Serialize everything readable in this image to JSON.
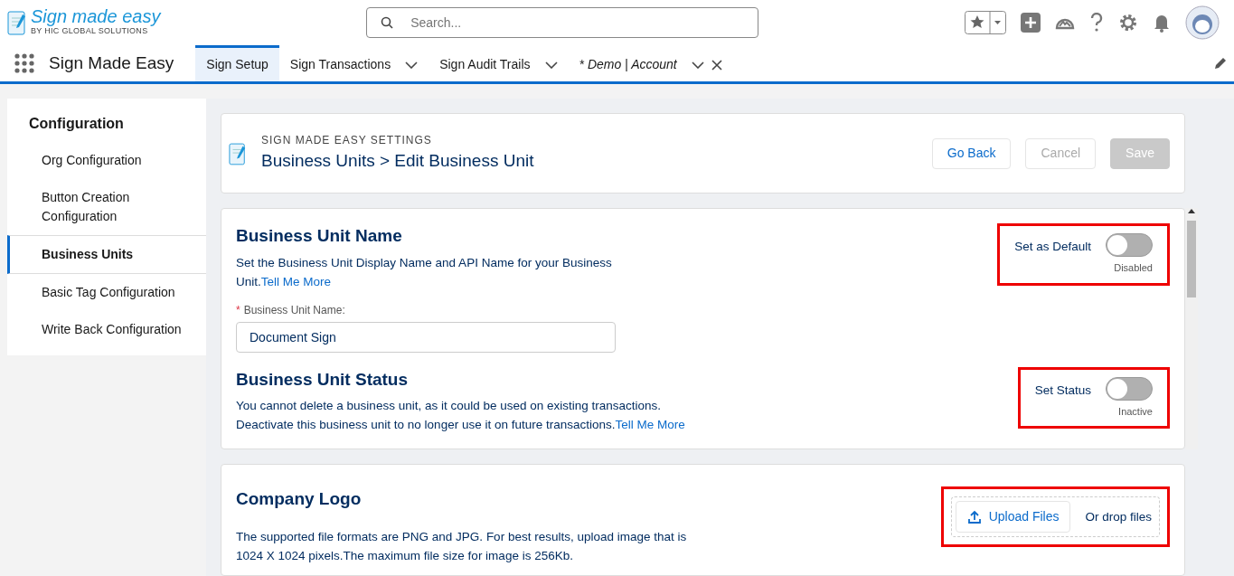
{
  "header": {
    "logo_title": "Sign made easy",
    "logo_subtitle": "BY HIC GLOBAL SOLUTIONS",
    "search": {
      "placeholder": "Search..."
    }
  },
  "nav": {
    "app_name": "Sign Made Easy",
    "tabs": [
      {
        "label": "Sign Setup",
        "selected": true,
        "italic": false,
        "dropdown": false,
        "closable": false
      },
      {
        "label": "Sign Transactions",
        "selected": false,
        "italic": false,
        "dropdown": true,
        "closable": false
      },
      {
        "label": "Sign Audit Trails",
        "selected": false,
        "italic": false,
        "dropdown": true,
        "closable": false
      },
      {
        "label": "* Demo | Account",
        "selected": false,
        "italic": true,
        "dropdown": true,
        "closable": true
      }
    ]
  },
  "sidebar": {
    "title": "Configuration",
    "items": [
      {
        "label": "Org Configuration",
        "selected": false
      },
      {
        "label": "Button Creation Configuration",
        "selected": false
      },
      {
        "label": "Business Units",
        "selected": true
      },
      {
        "label": "Basic Tag Configuration",
        "selected": false
      },
      {
        "label": "Write Back Configuration",
        "selected": false
      }
    ]
  },
  "page_header": {
    "eyebrow": "SIGN MADE EASY SETTINGS",
    "title": "Business Units > Edit Business Unit",
    "buttons": [
      {
        "label": "Go Back",
        "kind": "link"
      },
      {
        "label": "Cancel",
        "kind": "muted"
      },
      {
        "label": "Save",
        "kind": "disabled"
      }
    ]
  },
  "sections": [
    {
      "title": "Business Unit Name",
      "text": "Set the Business Unit Display Name and API Name for your Business Unit.",
      "link": "Tell Me More",
      "field": {
        "label": "Business Unit Name:",
        "required_mark": "*",
        "value": "Document Sign"
      },
      "toggle": {
        "label": "Set as Default",
        "on": false,
        "state_text": "Disabled",
        "highlighted": true
      }
    },
    {
      "title": "Business Unit Status",
      "text": "You cannot delete a business unit, as it could be used on existing transactions. Deactivate this business unit to no longer use it on future transactions.",
      "link": "Tell Me More",
      "toggle": {
        "label": "Set Status",
        "on": false,
        "state_text": "Inactive",
        "highlighted": true
      }
    }
  ],
  "logo_card": {
    "title": "Company Logo",
    "text": "The supported file formats are PNG and JPG. For best results, upload image that is 1024 X 1024 pixels.The maximum file size for image is 256Kb.",
    "upload_button": "Upload Files",
    "drop_text": "Or drop files",
    "highlighted": true
  }
}
